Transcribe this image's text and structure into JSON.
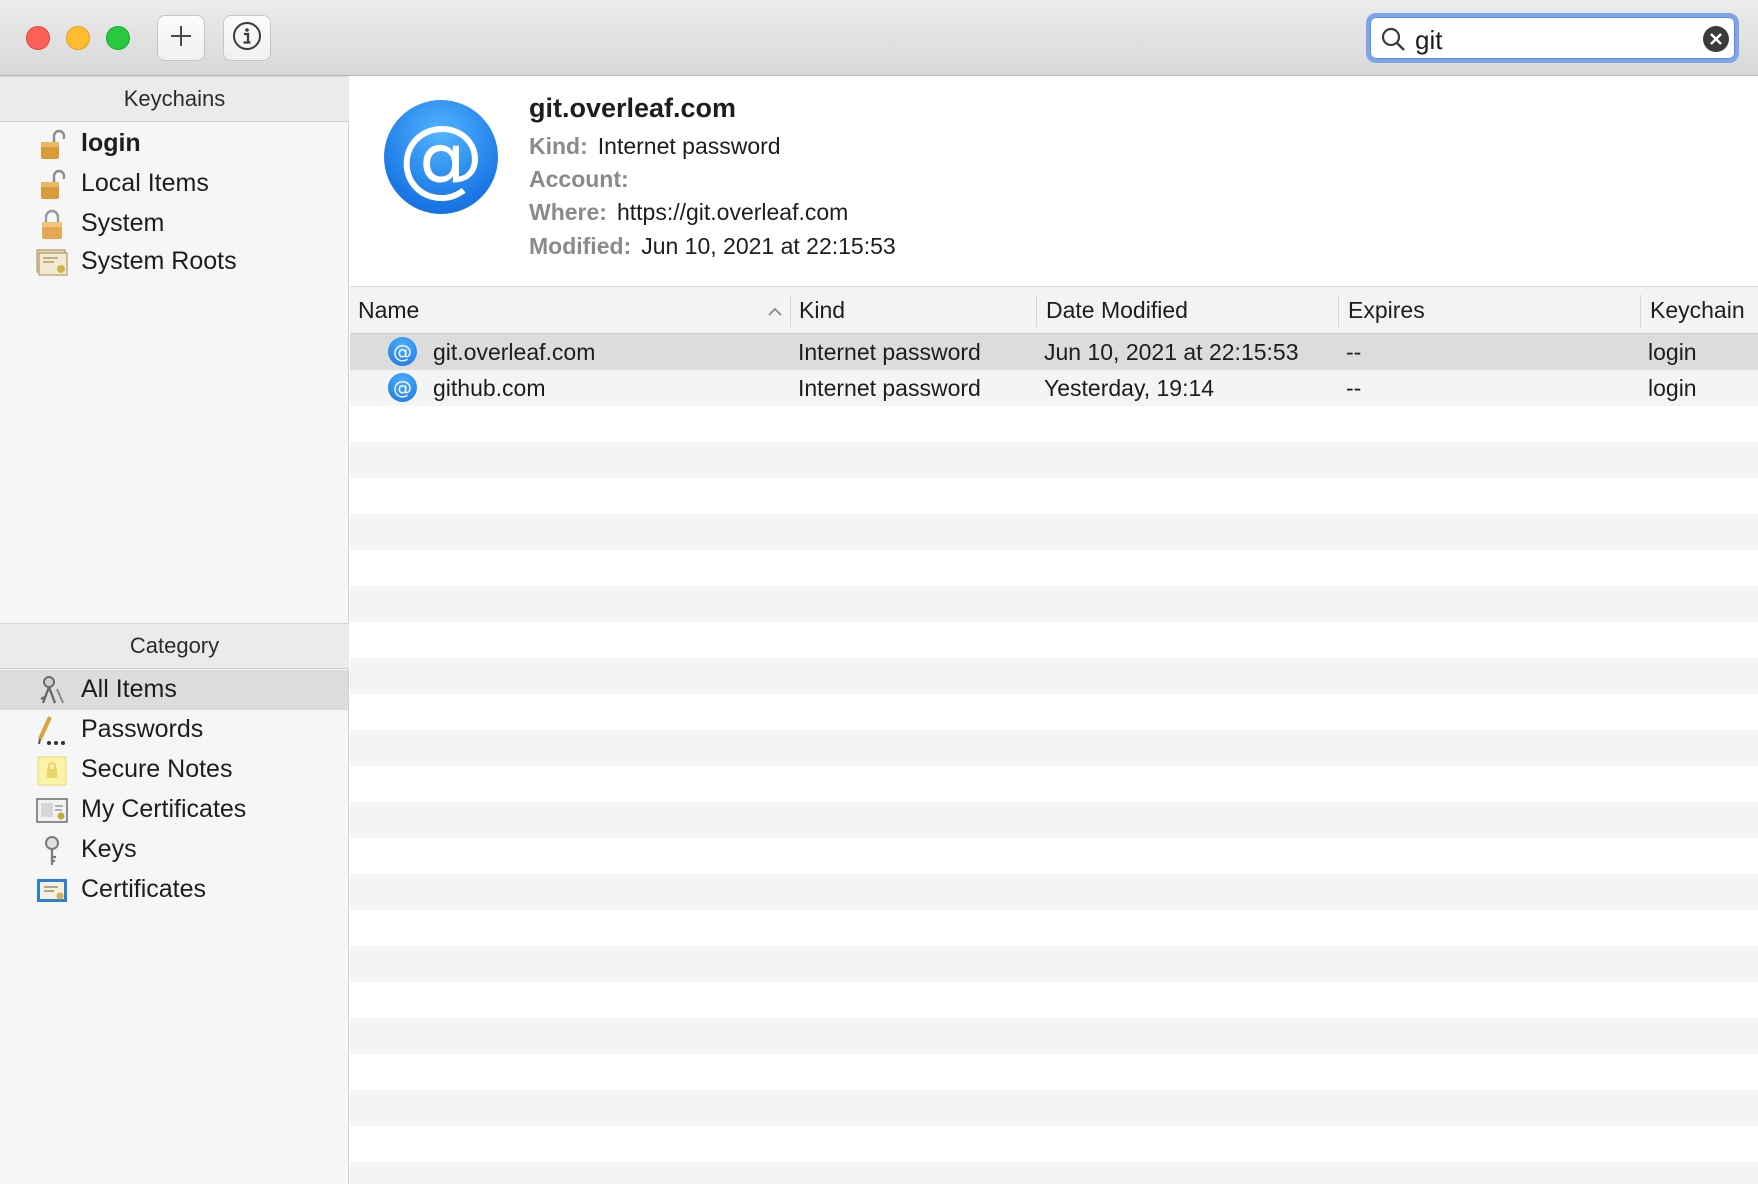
{
  "search": {
    "value": "git"
  },
  "sidebar": {
    "keychains_header": "Keychains",
    "keychains": [
      {
        "label": "login",
        "icon": "unlocked-padlock-icon"
      },
      {
        "label": "Local Items",
        "icon": "unlocked-padlock-icon"
      },
      {
        "label": "System",
        "icon": "locked-padlock-icon"
      },
      {
        "label": "System Roots",
        "icon": "certificate-stack-icon"
      }
    ],
    "category_header": "Category",
    "categories": [
      {
        "label": "All Items",
        "icon": "keys-icon"
      },
      {
        "label": "Passwords",
        "icon": "pen-dots-icon"
      },
      {
        "label": "Secure Notes",
        "icon": "note-lock-icon"
      },
      {
        "label": "My Certificates",
        "icon": "certificate-person-icon"
      },
      {
        "label": "Keys",
        "icon": "key-icon"
      },
      {
        "label": "Certificates",
        "icon": "certificate-icon"
      }
    ]
  },
  "detail": {
    "icon": "at-sign-icon",
    "title": "git.overleaf.com",
    "kind_key": "Kind:",
    "kind_value": "Internet password",
    "account_key": "Account:",
    "account_value": "",
    "where_key": "Where:",
    "where_value": "https://git.overleaf.com",
    "modified_key": "Modified:",
    "modified_value": "Jun 10, 2021 at 22:15:53"
  },
  "table": {
    "columns": [
      "Name",
      "Kind",
      "Date Modified",
      "Expires",
      "Keychain"
    ],
    "rows": [
      {
        "name": "git.overleaf.com",
        "kind": "Internet password",
        "date": "Jun 10, 2021 at 22:15:53",
        "expires": "--",
        "keychain": "login"
      },
      {
        "name": "github.com",
        "kind": "Internet password",
        "date": "Yesterday, 19:14",
        "expires": "--",
        "keychain": "login"
      }
    ]
  },
  "colors": {
    "accent": "#1a78e6",
    "selection": "#dcdcdc",
    "close": "#fe5f57",
    "minimize": "#febc2e",
    "maximize": "#28c840"
  }
}
